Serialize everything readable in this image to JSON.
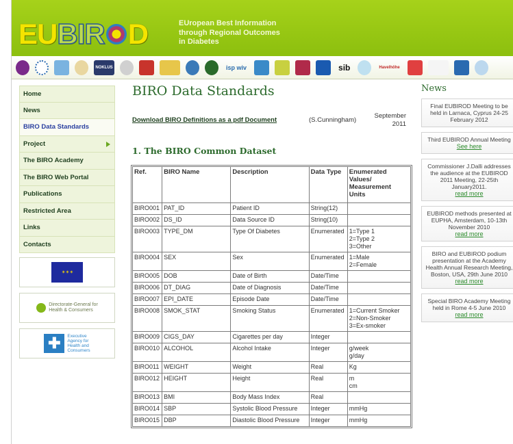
{
  "header": {
    "logo_letters": [
      "E",
      "U",
      "B",
      "I",
      "R",
      "D"
    ],
    "tagline_lines": [
      "EUropean Best Information",
      "through Regional Outcomes",
      "in Diabetes"
    ]
  },
  "partners": {
    "logos": [
      "partner-logo-1",
      "partner-logo-2",
      "partner-logo-3",
      "partner-logo-4",
      "nokloc-logo",
      "partner-logo-6",
      "partner-logo-7",
      "partner-logo-8",
      "partner-logo-9",
      "partner-logo-10",
      "isp-wiv-logo",
      "partner-logo-12",
      "partner-logo-13",
      "partner-logo-14",
      "partner-logo-15",
      "sib-logo",
      "partner-logo-17",
      "havelhöhe-logo",
      "partner-logo-19",
      "partner-logo-20",
      "partner-logo-21",
      "partner-logo-22"
    ],
    "nokloc_text": "NOKLUS",
    "isp_text": "isp wiv",
    "sib_text": "sib",
    "havel_text": "Havelhöhe"
  },
  "nav": {
    "items": [
      {
        "label": "Home"
      },
      {
        "label": "News"
      },
      {
        "label": "BIRO Data Standards"
      },
      {
        "label": "Project"
      },
      {
        "label": "The BIRO Academy"
      },
      {
        "label": "The BIRO Web Portal"
      },
      {
        "label": "Publications"
      },
      {
        "label": "Restricted Area"
      },
      {
        "label": "Links"
      },
      {
        "label": "Contacts"
      }
    ]
  },
  "sponsors": {
    "dg_health_lines": [
      "Directorate-General for",
      "Health & Consumers"
    ],
    "agency_lines": [
      "Executive",
      "Agency for",
      "Health and",
      "Consumers"
    ]
  },
  "main": {
    "title": "BIRO Data Standards",
    "download_link": "Download BIRO Definitions as a pdf Document",
    "download_author": "(S.Cunningham)",
    "download_date_lines": [
      "September",
      "2011"
    ],
    "section_title": "1. The BIRO Common Dataset",
    "table_headers": [
      "Ref.",
      "BIRO Name",
      "Description",
      "Data Type",
      "Enumerated Values/ Measurement Units"
    ],
    "table_rows": [
      {
        "ref": "BIRO001",
        "name": "PAT_ID",
        "desc": "Patient ID",
        "type": "String(12)",
        "enum": []
      },
      {
        "ref": "BIRO002",
        "name": "DS_ID",
        "desc": "Data Source ID",
        "type": "String(10)",
        "enum": []
      },
      {
        "ref": "BIRO003",
        "name": "TYPE_DM",
        "desc": "Type Of Diabetes",
        "type": "Enumerated",
        "enum": [
          "1=Type 1",
          "2=Type 2",
          "3=Other"
        ]
      },
      {
        "ref": "BIRO004",
        "name": "SEX",
        "desc": "Sex",
        "type": "Enumerated",
        "enum": [
          "1=Male",
          "2=Female"
        ]
      },
      {
        "ref": "BIRO005",
        "name": "DOB",
        "desc": "Date of Birth",
        "type": "Date/Time",
        "enum": []
      },
      {
        "ref": "BIRO006",
        "name": "DT_DIAG",
        "desc": "Date of Diagnosis",
        "type": "Date/Time",
        "enum": []
      },
      {
        "ref": "BIRO007",
        "name": "EPI_DATE",
        "desc": "Episode Date",
        "type": "Date/Time",
        "enum": []
      },
      {
        "ref": "BIRO008",
        "name": "SMOK_STAT",
        "desc": "Smoking Status",
        "type": "Enumerated",
        "enum": [
          "1=Current Smoker",
          "2=Non-Smoker",
          "3=Ex-smoker"
        ]
      },
      {
        "ref": "BIRO009",
        "name": "CIGS_DAY",
        "desc": "Cigarettes per day",
        "type": "Integer",
        "enum": []
      },
      {
        "ref": "BIRO010",
        "name": "ALCOHOL",
        "desc": "Alcohol Intake",
        "type": "Integer",
        "enum": [
          "g/week",
          "g/day"
        ]
      },
      {
        "ref": "BIRO011",
        "name": "WEIGHT",
        "desc": "Weight",
        "type": "Real",
        "enum": [
          "Kg"
        ]
      },
      {
        "ref": "BIRO012",
        "name": "HEIGHT",
        "desc": "Height",
        "type": "Real",
        "enum": [
          "m",
          "cm"
        ]
      },
      {
        "ref": "BIRO013",
        "name": "BMI",
        "desc": "Body Mass Index",
        "type": "Real",
        "enum": []
      },
      {
        "ref": "BIRO014",
        "name": "SBP",
        "desc": "Systolic Blood Pressure",
        "type": "Integer",
        "enum": [
          "mmHg"
        ]
      },
      {
        "ref": "BIRO015",
        "name": "DBP",
        "desc": "Diastolic Blood Pressure",
        "type": "Integer",
        "enum": [
          "mmHg"
        ]
      }
    ]
  },
  "news": {
    "title": "News",
    "items": [
      {
        "text": "Final EUBIROD Meeting to be held in Larnaca, Cyprus 24-25 February 2012",
        "link": ""
      },
      {
        "text": "Third EUBIROD Annual Meeting",
        "link": "See here"
      },
      {
        "text": "Commissioner J.Dalli addresses the audience at the EUBIROD 2011 Meeting, 22-25th January2011.",
        "link": "read more"
      },
      {
        "text": "EUBIROD methods presented at EUPHA, Amsterdam, 10-13th November 2010",
        "link": "read more"
      },
      {
        "text": "BIRO and EUBIROD podium presentation at the Academy Health Annual Research Meeting, Boston, USA, 29th June 2010",
        "link": "read more"
      },
      {
        "text": "Special BIRO Academy Meeting held in Rome 4-5 June 2010",
        "link": "read more"
      }
    ]
  },
  "colors": {
    "header_green": "#8cbf0e",
    "logo_yellow": "#f4e400",
    "heading_green": "#2c6a2c",
    "nav_bg": "#eef4dc",
    "active_nav": "#2a3fa0",
    "news_link": "#2a8a2a"
  }
}
